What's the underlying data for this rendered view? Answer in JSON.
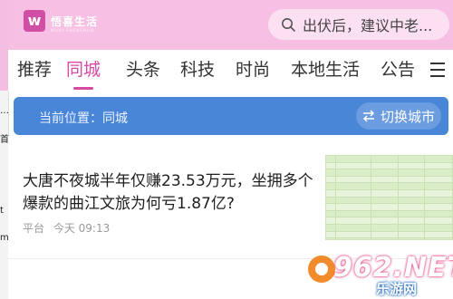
{
  "left_edge": {
    "glyphs": [
      "…",
      "P",
      "首",
      "t",
      "m"
    ]
  },
  "header": {
    "brand_name": "悟喜生活",
    "brand_sub": "WUXI SHENGHUO",
    "search_placeholder": "出伏后，建议中老..."
  },
  "nav": {
    "tabs": [
      {
        "label": "推荐"
      },
      {
        "label": "同城"
      },
      {
        "label": "头条"
      },
      {
        "label": "科技"
      },
      {
        "label": "时尚"
      },
      {
        "label": "本地生活"
      },
      {
        "label": "公告"
      }
    ]
  },
  "location": {
    "label": "当前位置：同城",
    "switch_label": "切换城市"
  },
  "article": {
    "title": "大唐不夜城半年仅赚23.53万元，坐拥多个爆款的曲江文旅为何亏1.87亿?",
    "source": "平台",
    "time": "今天 09:13"
  },
  "watermark": {
    "main": "962.NET",
    "sub": "乐游网"
  },
  "colors": {
    "header_bg": "#f6bfe3",
    "accent": "#d64aa3",
    "location_bar": "#4a86d8"
  }
}
